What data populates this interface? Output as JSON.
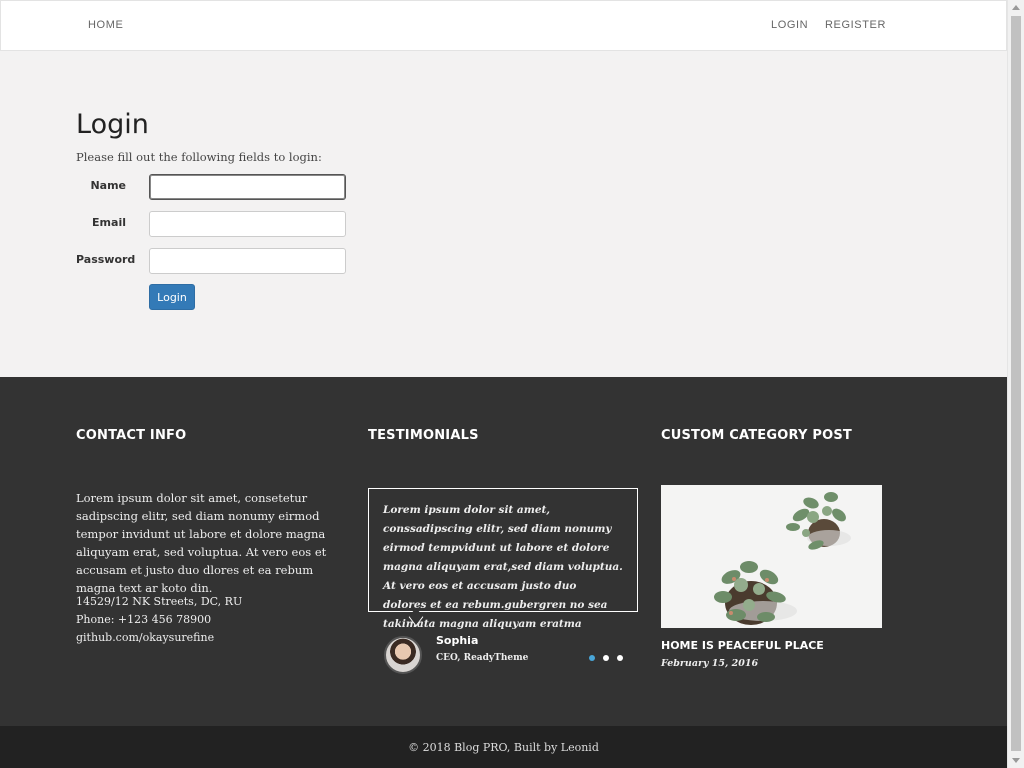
{
  "nav": {
    "home": "HOME",
    "login": "LOGIN",
    "register": "REGISTER"
  },
  "login": {
    "title": "Login",
    "description": "Please fill out the following fields to login:",
    "fields": {
      "name_label": "Name",
      "name_value": "",
      "email_label": "Email",
      "email_value": "",
      "password_label": "Password",
      "password_value": ""
    },
    "submit_label": "Login"
  },
  "footer": {
    "contact": {
      "heading": "CONTACT INFO",
      "body": "Lorem ipsum dolor sit amet, consetetur sadipscing elitr, sed diam nonumy eirmod tempor invidunt ut labore et dolore magna aliquyam erat, sed voluptua. At vero eos et accusam et justo duo dlores et ea rebum magna text ar koto din.",
      "address": "14529/12 NK Streets, DC, RU",
      "phone": "Phone: +123 456 78900",
      "github": "github.com/okaysurefine"
    },
    "testimonials": {
      "heading": "TESTIMONIALS",
      "text": "Lorem ipsum dolor sit amet, conssadipscing elitr, sed diam nonumy eirmod tempvidunt ut labore et dolore magna aliquyam erat,sed diam voluptua. At vero eos et accusam justo duo dolores et ea rebum.gubergren no sea takimata magna aliquyam eratma",
      "author_name": "Sophia",
      "author_role": "CEO, ReadyTheme",
      "active_slide": 1,
      "slide_count": 3
    },
    "category": {
      "heading": "CUSTOM CATEGORY POST",
      "post_title": "HOME IS PEACEFUL PLACE",
      "post_date": "February 15, 2016"
    },
    "copyright": "© 2018 Blog PRO, Built by Leonid"
  },
  "icons": {
    "scroll_up": "arrow-up-icon",
    "scroll_down": "arrow-down-icon"
  },
  "colors": {
    "primary_button": "#337ab7",
    "footer_bg": "#333333",
    "copyright_bg": "#222222",
    "page_bg": "#f3f2f2",
    "active_dot": "#49a6d8"
  }
}
